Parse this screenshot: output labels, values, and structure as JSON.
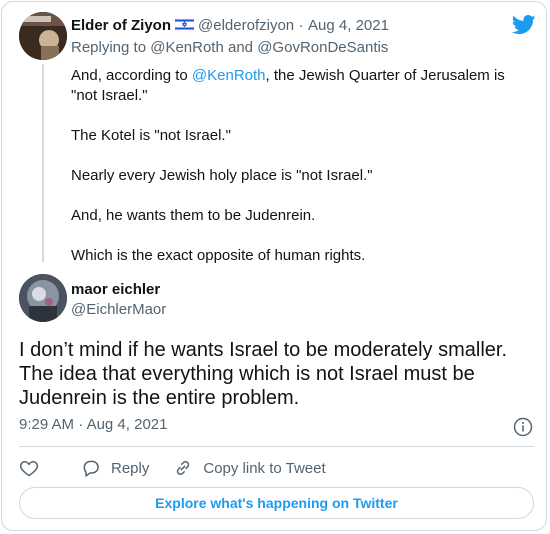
{
  "parent": {
    "author_name": "Elder of Ziyon",
    "author_handle": "@elderofziyon",
    "separator": "·",
    "date": "Aug 4, 2021",
    "reply_prefix": "Replying to",
    "reply_user1": "@KenRoth",
    "reply_and": "and",
    "reply_user2": "@GovRonDeSantis",
    "p1_a": "And, according to",
    "p1_link": "@KenRoth",
    "p1_b": ", the Jewish Quarter of Jerusalem is",
    "p1_c": "\"not Israel.\"",
    "p2": "The Kotel is \"not Israel.\"",
    "p3": "Nearly every Jewish holy place is \"not Israel.\"",
    "p4": "And, he wants them to be Judenrein.",
    "p5": "Which is the exact opposite of human rights."
  },
  "main": {
    "author_name": "maor eichler",
    "author_handle": "@EichlerMaor",
    "line1": "I don’t mind if he wants Israel to be moderately smaller.",
    "line2": "The idea that everything which is not Israel must be",
    "line3": "Judenrein is the entire problem.",
    "time": "9:29 AM",
    "separator": "·",
    "date": "Aug 4, 2021"
  },
  "actions": {
    "reply_label": "Reply",
    "copy_label": "Copy link to Tweet"
  },
  "explore_label": "Explore what's happening on Twitter",
  "colors": {
    "accent": "#1d9bf0",
    "text": "#0f1419",
    "muted": "#536471",
    "border": "#cfd9de"
  }
}
